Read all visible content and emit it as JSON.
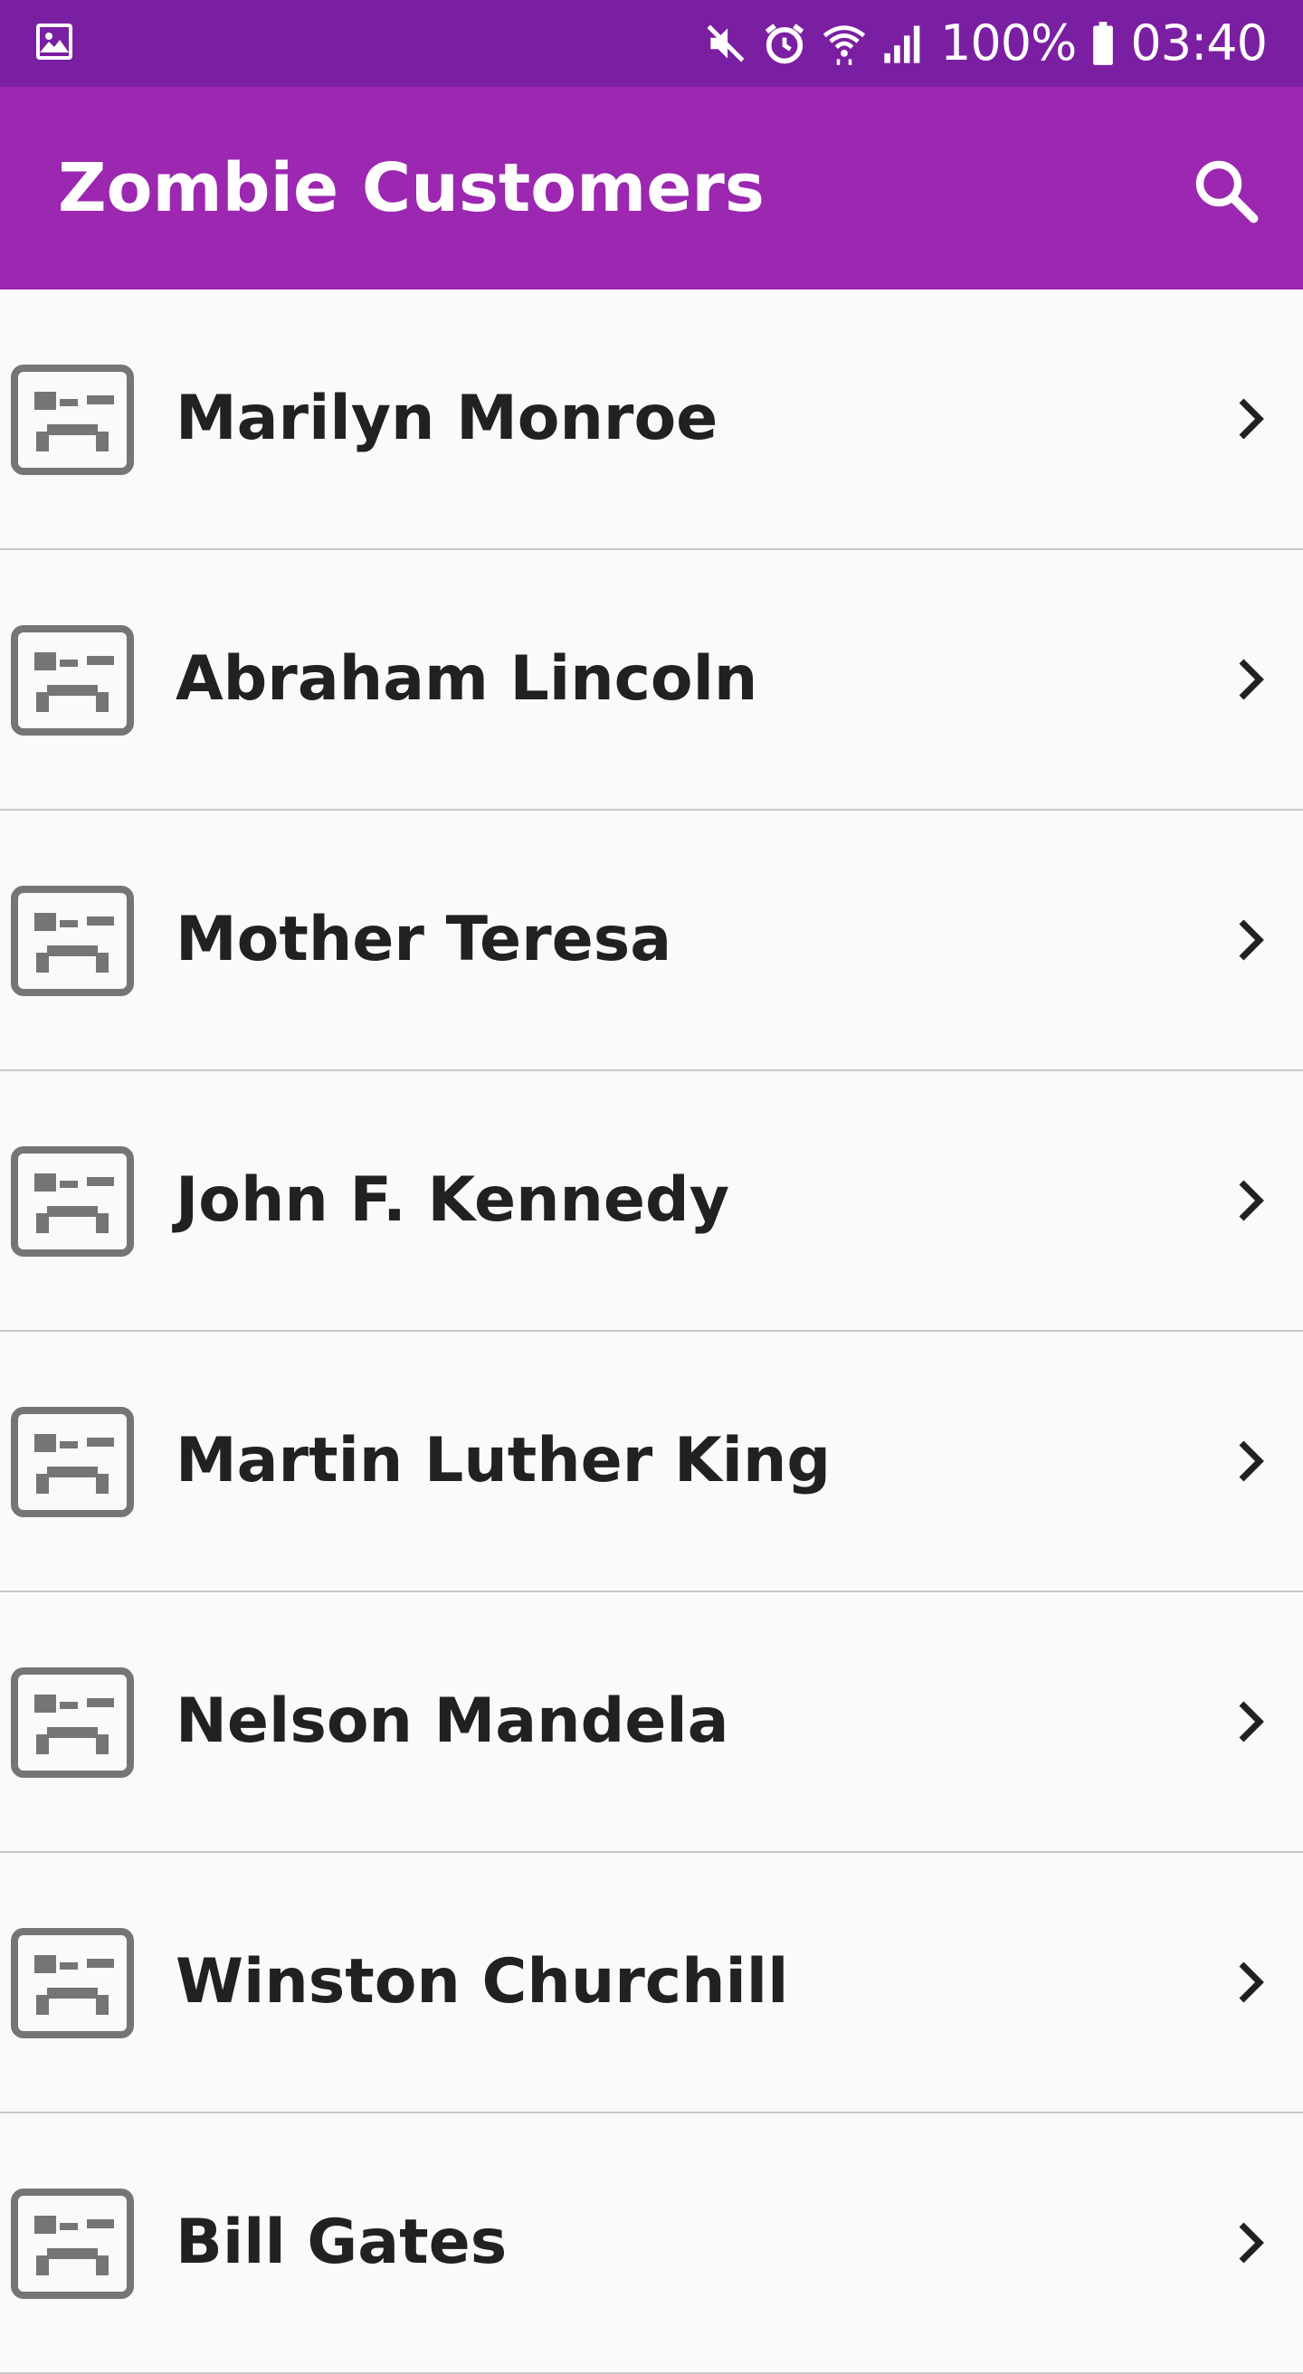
{
  "status_bar": {
    "left_icon": "image-icon",
    "icons": [
      "mute-icon",
      "alarm-icon",
      "wifi-icon",
      "signal-icon"
    ],
    "battery_text": "100%",
    "battery_icon": "battery-icon",
    "time": "03:40"
  },
  "app_bar": {
    "title": "Zombie Customers",
    "action_icon": "search-icon",
    "background": "#9c27b0",
    "status_background": "#7b1fa2"
  },
  "customers": [
    {
      "name": "Marilyn Monroe"
    },
    {
      "name": "Abraham Lincoln"
    },
    {
      "name": "Mother Teresa"
    },
    {
      "name": "John F. Kennedy"
    },
    {
      "name": "Martin Luther King"
    },
    {
      "name": "Nelson Mandela"
    },
    {
      "name": "Winston Churchill"
    },
    {
      "name": "Bill Gates"
    }
  ],
  "row_icon": "zombie-avatar-icon",
  "row_action_icon": "chevron-right-icon"
}
